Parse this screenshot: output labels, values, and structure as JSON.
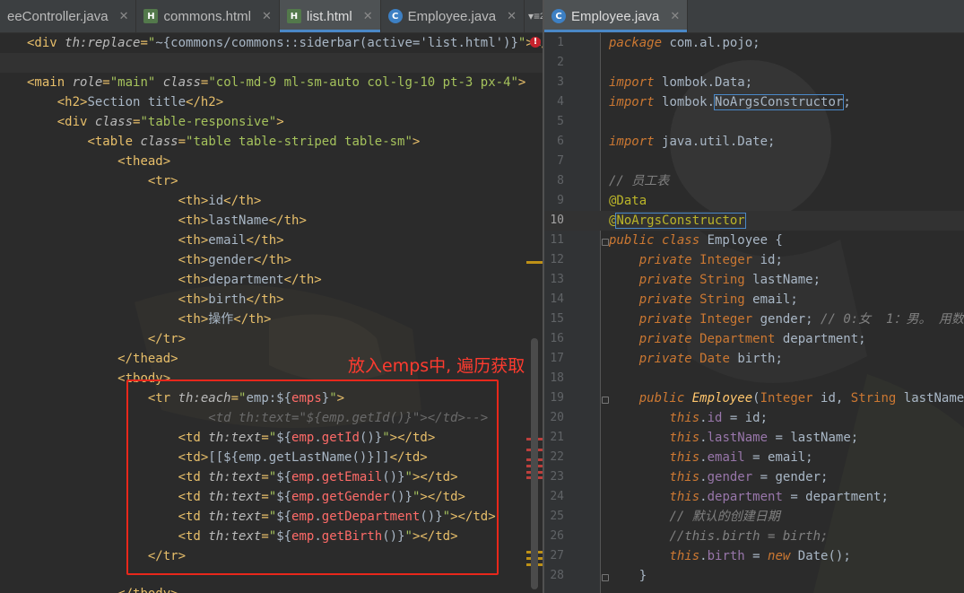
{
  "tabs_left": [
    {
      "label": "eeController.java",
      "icon": "java-class-icon",
      "active": false
    },
    {
      "label": "commons.html",
      "icon": "html-file-icon",
      "active": false
    },
    {
      "label": "list.html",
      "icon": "html-file-icon",
      "active": true
    },
    {
      "label": "Employee.java",
      "icon": "java-class-icon",
      "active": false
    }
  ],
  "tabs_overflow": "2",
  "tabs_right": [
    {
      "label": "Employee.java",
      "icon": "java-class-icon",
      "active": true
    }
  ],
  "annotation": "放入emps中, 遍历获取",
  "java_line_numbers": [
    "1",
    "2",
    "3",
    "4",
    "5",
    "6",
    "7",
    "8",
    "9",
    "10",
    "11",
    "12",
    "13",
    "14",
    "15",
    "16",
    "17",
    "18",
    "19",
    "20",
    "21",
    "22",
    "23",
    "24",
    "25",
    "26",
    "27",
    "28"
  ],
  "colors": {
    "tag": "#e8bf6a",
    "string": "#a5c25c",
    "keyword": "#cc7832",
    "annotation_red": "#e8271b",
    "accent": "#4a88c7"
  }
}
